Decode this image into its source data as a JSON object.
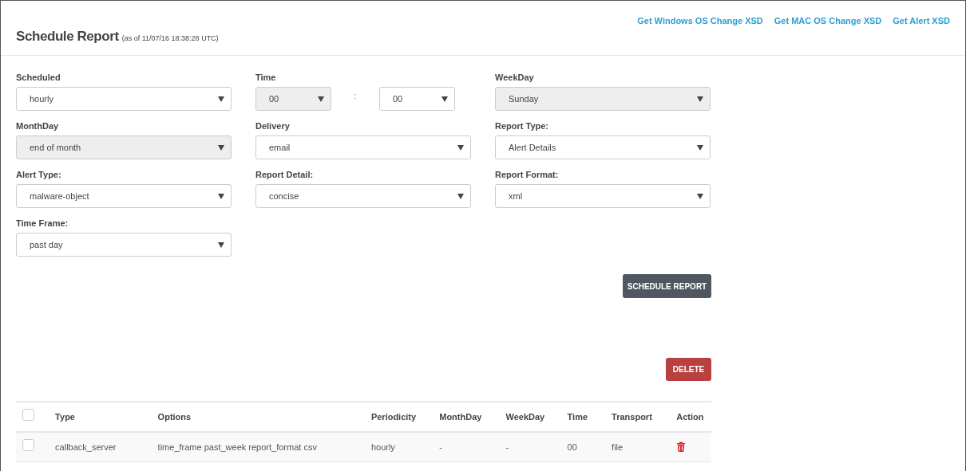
{
  "header": {
    "title": "Schedule Report",
    "timestamp": "(as of 11/07/16 18:38:28 UTC)",
    "links": [
      "Get Windows OS Change XSD",
      "Get MAC OS Change XSD",
      "Get Alert XSD"
    ]
  },
  "form": {
    "fields": [
      {
        "kind": "select",
        "label": "Scheduled",
        "value": "hourly",
        "disabled": false
      },
      {
        "kind": "time",
        "label": "Time",
        "separator": ":",
        "hour": {
          "value": "00",
          "disabled": true
        },
        "minute": {
          "value": "00",
          "disabled": false
        }
      },
      {
        "kind": "select",
        "label": "WeekDay",
        "value": "Sunday",
        "disabled": true
      },
      {
        "kind": "select",
        "label": "MonthDay",
        "value": "end of month",
        "disabled": true
      },
      {
        "kind": "select",
        "label": "Delivery",
        "value": "email",
        "disabled": false
      },
      {
        "kind": "select",
        "label": "Report Type:",
        "value": "Alert Details",
        "disabled": false
      },
      {
        "kind": "select",
        "label": "Alert Type:",
        "value": "malware-object",
        "disabled": false
      },
      {
        "kind": "select",
        "label": "Report Detail:",
        "value": "concise",
        "disabled": false
      },
      {
        "kind": "select",
        "label": "Report Format:",
        "value": "xml",
        "disabled": false
      },
      {
        "kind": "select",
        "label": "Time Frame:",
        "value": "past day",
        "disabled": false
      }
    ],
    "submit": "SCHEDULE REPORT"
  },
  "delete_button": "DELETE",
  "table": {
    "select_all_checked": false,
    "columns": [
      "Type",
      "Options",
      "Periodicity",
      "MonthDay",
      "WeekDay",
      "Time",
      "Transport",
      "Action"
    ],
    "rows": [
      {
        "checked": false,
        "cells": [
          "callback_server",
          "time_frame past_week report_format csv",
          "hourly",
          "-",
          "-",
          "00",
          "file"
        ]
      }
    ]
  }
}
